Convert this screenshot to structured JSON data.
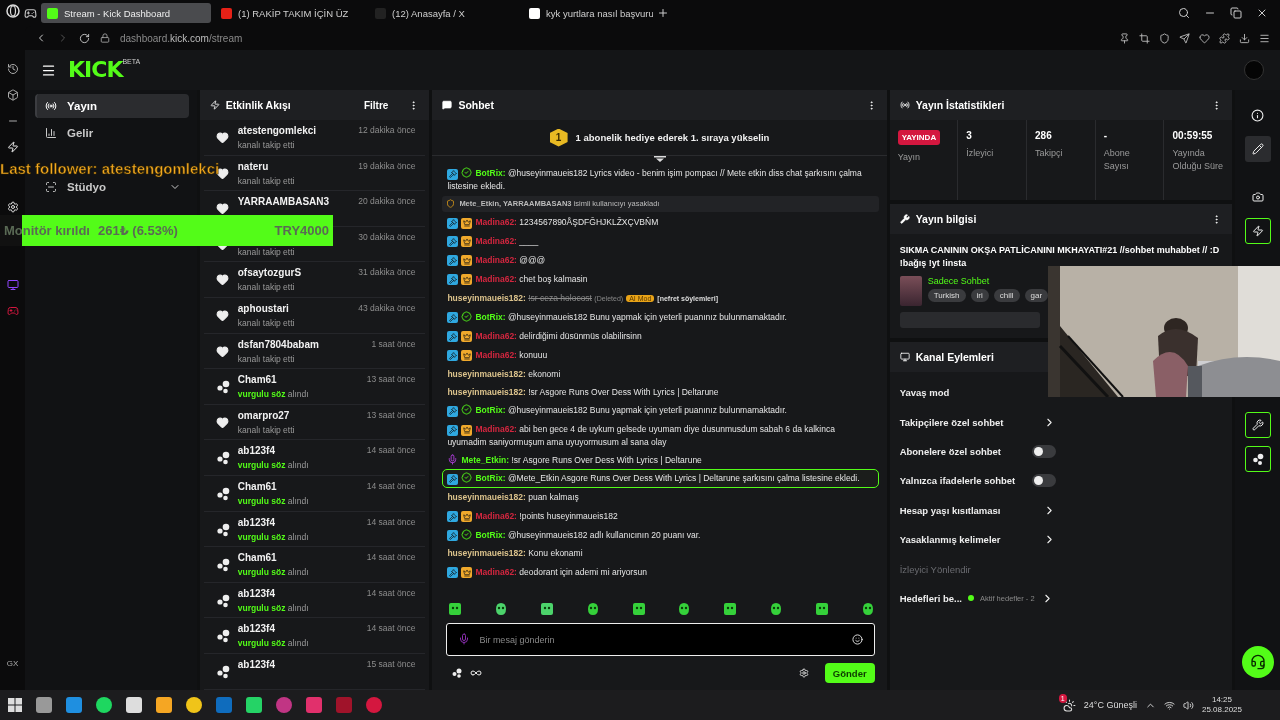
{
  "browser": {
    "tabs": [
      {
        "title": "Stream - Kick Dashboard",
        "selected": true,
        "kind": "kick"
      },
      {
        "title": "(1) RAKİP TAKIM İÇİN ÜZ",
        "selected": false,
        "kind": "youtube"
      },
      {
        "title": "(12) Anasayfa / X",
        "selected": false,
        "kind": "x"
      },
      {
        "title": "kyk yurtlara nasıl başvuru",
        "selected": false,
        "kind": "google"
      }
    ],
    "url_host": "dashboard.",
    "url_domain": "kick.com",
    "url_path": "/stream",
    "rail_label": "GX"
  },
  "header": {
    "logo": "KICK",
    "logo_tag": "BETA"
  },
  "nav": {
    "items": [
      {
        "kind": "item",
        "label": "Yayın",
        "selected": true
      },
      {
        "kind": "item",
        "label": "Gelir",
        "selected": false
      },
      {
        "kind": "covered"
      },
      {
        "kind": "expandable",
        "label": "Stüdyo",
        "selected": false
      }
    ]
  },
  "feed": {
    "title": "Etkinlik Akışı",
    "filter": "Filtre",
    "items": [
      {
        "kind": "follow",
        "name": "atestengomlekci",
        "action": "kanalı takip etti",
        "time": "12 dakika önce"
      },
      {
        "kind": "follow",
        "name": "nateru",
        "action": "kanalı takip etti",
        "time": "19 dakika önce"
      },
      {
        "kind": "follow",
        "name": "YARRAAMBASAN3",
        "time": "20 dakika önce"
      },
      {
        "kind": "follow",
        "action": "kanalı takip etti",
        "time": "30 dakika önce"
      },
      {
        "kind": "follow",
        "name": "ofsaytozgurS",
        "action": "kanalı takip etti",
        "time": "31 dakika önce"
      },
      {
        "kind": "follow",
        "name": "aphoustari",
        "action": "kanalı takip etti",
        "time": "43 dakika önce"
      },
      {
        "kind": "follow",
        "name": "dsfan7804babam",
        "action": "kanalı takip etti",
        "time": "1 saat önce"
      },
      {
        "kind": "points",
        "name": "Cham61",
        "highlight": "vurgulu söz",
        "action": "alındı",
        "time": "13 saat önce"
      },
      {
        "kind": "follow",
        "name": "omarpro27",
        "action": "kanalı takip etti",
        "time": "13 saat önce"
      },
      {
        "kind": "points",
        "name": "ab123f4",
        "highlight": "vurgulu söz",
        "action": "alındı",
        "time": "14 saat önce"
      },
      {
        "kind": "points",
        "name": "Cham61",
        "highlight": "vurgulu söz",
        "action": "alındı",
        "time": "14 saat önce"
      },
      {
        "kind": "points",
        "name": "ab123f4",
        "highlight": "vurgulu söz",
        "action": "alındı",
        "time": "14 saat önce"
      },
      {
        "kind": "points",
        "name": "Cham61",
        "highlight": "vurgulu söz",
        "action": "alındı",
        "time": "14 saat önce"
      },
      {
        "kind": "points",
        "name": "ab123f4",
        "highlight": "vurgulu söz",
        "action": "alındı",
        "time": "14 saat önce"
      },
      {
        "kind": "points",
        "name": "ab123f4",
        "highlight": "vurgulu söz",
        "action": "alındı",
        "time": "14 saat önce"
      },
      {
        "kind": "points",
        "name": "ab123f4",
        "time": "15 saat önce"
      }
    ]
  },
  "chat": {
    "title": "Sohbet",
    "banner_rank": "1",
    "banner": "1 abonelik hediye ederek 1. sıraya yükselin",
    "messages": [
      {
        "kind": "message",
        "badges": [
          {
            "kind": "mod"
          },
          {
            "kind": "bot"
          }
        ],
        "name": "BotRix:",
        "color": "#53fc18",
        "text": "@huseyinmaueis182 Lyrics video - benim işim pompacı // Mete etkin diss chat şarkısını çalma listesine ekledi."
      },
      {
        "kind": "system",
        "text": "**Mete_Etkin, YARRAAMBASAN3** isimli kullanıcıyı yasakladı"
      },
      {
        "kind": "message",
        "badges": [
          {
            "kind": "mod"
          },
          {
            "kind": "vip"
          }
        ],
        "name": "Madina62:",
        "color": "#d3263f",
        "text": "1234567890ÅŞDFĞHJKLŽXÇVBŇM"
      },
      {
        "kind": "message",
        "badges": [
          {
            "kind": "mod"
          },
          {
            "kind": "vip"
          }
        ],
        "name": "Madina62:",
        "color": "#d3263f",
        "text": "____"
      },
      {
        "kind": "message",
        "badges": [
          {
            "kind": "mod"
          },
          {
            "kind": "vip"
          }
        ],
        "name": "Madina62:",
        "color": "#d3263f",
        "text": "@@@"
      },
      {
        "kind": "message",
        "badges": [
          {
            "kind": "mod"
          },
          {
            "kind": "vip"
          }
        ],
        "name": "Madina62:",
        "color": "#d3263f",
        "text": "chet boş kalmasin"
      },
      {
        "kind": "deleted",
        "name": "huseyinmaueis182:",
        "color": "#dcc38c",
        "text": "!sr ceza holocost",
        "deleted_label": "(Deleted)",
        "mod_label": "AI Mod",
        "reason": "[nefret söylemleri]"
      },
      {
        "kind": "message",
        "badges": [
          {
            "kind": "mod"
          },
          {
            "kind": "bot"
          }
        ],
        "name": "BotRix:",
        "color": "#53fc18",
        "text": "@huseyinmaueis182 Bunu yapmak için yeterli puanınız bulunmamaktadır."
      },
      {
        "kind": "message",
        "badges": [
          {
            "kind": "mod"
          },
          {
            "kind": "vip"
          }
        ],
        "name": "Madina62:",
        "color": "#d3263f",
        "text": "delirdiğimi düsünmüs olabilirsinn"
      },
      {
        "kind": "message",
        "badges": [
          {
            "kind": "mod"
          },
          {
            "kind": "vip"
          }
        ],
        "name": "Madina62:",
        "color": "#d3263f",
        "text": "konuuu"
      },
      {
        "kind": "message",
        "name": "huseyinmaueis182:",
        "color": "#dcc38c",
        "text": "ekonomi"
      },
      {
        "kind": "message",
        "name": "huseyinmaueis182:",
        "color": "#dcc38c",
        "text": "!sr Asgore Runs Over Dess With Lyrics | Deltarune"
      },
      {
        "kind": "message",
        "badges": [
          {
            "kind": "mod"
          },
          {
            "kind": "bot"
          }
        ],
        "name": "BotRix:",
        "color": "#53fc18",
        "text": "@huseyinmaueis182 Bunu yapmak için yeterli puanınız bulunmamaktadır."
      },
      {
        "kind": "message",
        "badges": [
          {
            "kind": "mod"
          },
          {
            "kind": "vip"
          }
        ],
        "name": "Madina62:",
        "color": "#d3263f",
        "text": "abi ben gece 4 de uykum gelsede uyumam diye dusunmusdum sabah 6 da kalkinca uyumadim saniyormuşum ama uyuyormusum al sana olay"
      },
      {
        "kind": "message",
        "badges": [
          {
            "kind": "mic"
          }
        ],
        "name": "Mete_Etkin:",
        "color": "#53fc18",
        "text": "!sr Asgore Runs Over Dess With Lyrics | Deltarune"
      },
      {
        "kind": "highlight",
        "badges": [
          {
            "kind": "mod"
          },
          {
            "kind": "bot"
          }
        ],
        "name": "BotRix:",
        "color": "#53fc18",
        "text": "@Mete_Etkin Asgore Runs Over Dess With Lyrics | Deltarune şarkısını çalma listesine ekledi."
      },
      {
        "kind": "message",
        "name": "huseyinmaueis182:",
        "color": "#dcc38c",
        "text": "puan kalmaış"
      },
      {
        "kind": "message",
        "badges": [
          {
            "kind": "mod"
          },
          {
            "kind": "vip"
          }
        ],
        "name": "Madina62:",
        "color": "#d3263f",
        "text": "!points huseyinmaueis182"
      },
      {
        "kind": "message",
        "badges": [
          {
            "kind": "mod"
          },
          {
            "kind": "bot"
          }
        ],
        "name": "BotRix:",
        "color": "#53fc18",
        "text": "@huseyinmaueis182 adlı kullanıcının 20 puanı var."
      },
      {
        "kind": "message",
        "name": "huseyinmaueis182:",
        "color": "#dcc38c",
        "text": "Konu ekonami"
      },
      {
        "kind": "message",
        "badges": [
          {
            "kind": "mod"
          },
          {
            "kind": "vip"
          }
        ],
        "name": "Madina62:",
        "color": "#d3263f",
        "text": "deodorant için ademi mi ariyorsun"
      }
    ],
    "input": {
      "placeholder": "Bir mesaj gönderin"
    },
    "send": "Gönder"
  },
  "stats": {
    "title": "Yayın İstatistikleri",
    "live_badge": "YAYINDA",
    "live_label": "Yayın",
    "items": [
      {
        "value": "3",
        "label": "İzleyici"
      },
      {
        "value": "286",
        "label": "Takipçi"
      },
      {
        "value": "-",
        "label": "Abone Sayısı"
      },
      {
        "value": "00:59:55",
        "label": "Yayında Olduğu Süre"
      }
    ]
  },
  "stream_info": {
    "title": "Yayın bilgisi",
    "stream_title": "SIKMA CANININ OKŞA PATLİCANINI MKHAYATI#21 //sohbet muhabbet // :D !bağış !yt !insta",
    "category": "Sadece Sohbet",
    "tags": [
      "Turkish",
      "iri",
      "chill",
      "gar"
    ]
  },
  "channel_actions": {
    "title": "Kanal Eylemleri",
    "rows": [
      {
        "kind": "plain",
        "label": "Yavaş mod"
      },
      {
        "kind": "link",
        "label": "Takipçilere özel sohbet"
      },
      {
        "kind": "toggle",
        "label": "Abonelere özel sohbet",
        "on": false
      },
      {
        "kind": "toggle",
        "label": "Yalnızca ifadelerle sohbet",
        "on": false
      },
      {
        "kind": "link",
        "label": "Hesap yaşı kısıtlaması"
      },
      {
        "kind": "link",
        "label": "Yasaklanmış kelimeler"
      },
      {
        "kind": "section",
        "label": "İzleyici Yönlendir"
      },
      {
        "kind": "goal",
        "label": "Hedefleri be...",
        "status": "Aktif hedefler - 2",
        "color": "#53fc18"
      }
    ]
  },
  "overlays": {
    "last_follower": "Last follower: atestengomlekci",
    "goal_label": "Monitör kırıldı",
    "goal_amount": "261₺ (6.53%)",
    "goal_target": "TRY4000"
  },
  "taskbar": {
    "weather": "24°C Güneşli",
    "weather_alerts": "1",
    "time": "14:25",
    "date": "25.08.2025"
  }
}
